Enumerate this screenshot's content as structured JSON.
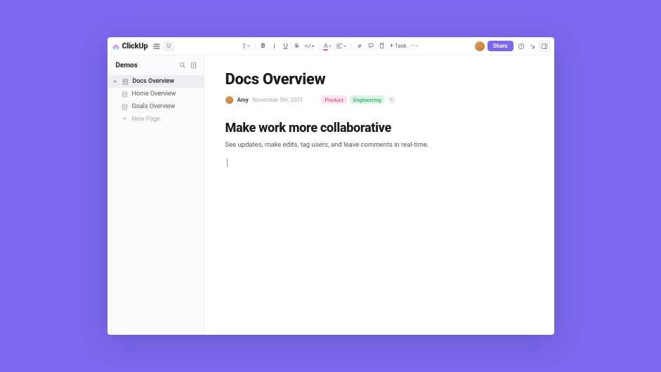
{
  "brand": {
    "name": "ClickUp"
  },
  "topbar": {
    "task_label": "Task",
    "share_label": "Share"
  },
  "sidebar": {
    "title": "Demos",
    "items": [
      {
        "label": "Docs Overview",
        "active": true
      },
      {
        "label": "Home Overview"
      },
      {
        "label": "Goals Overview"
      }
    ],
    "new_page": "New Page"
  },
  "doc": {
    "title": "Docs Overview",
    "author": "Amy",
    "date": "November 5th, 2021",
    "tags": [
      {
        "label": "Product",
        "kind": "product"
      },
      {
        "label": "Engineering",
        "kind": "eng"
      }
    ],
    "section_heading": "Make work more collaborative",
    "section_body": "See updates, make edits, tag users, and leave comments in real-time."
  }
}
